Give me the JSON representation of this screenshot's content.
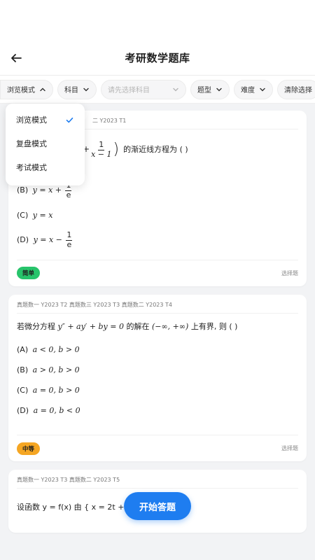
{
  "header": {
    "title": "考研数学题库"
  },
  "filters": {
    "mode": "浏览模式",
    "subject": "科目",
    "subject_select_placeholder": "请先选择科目",
    "type": "题型",
    "difficulty": "难度",
    "clear": "清除选择"
  },
  "mode_menu": {
    "items": [
      "浏览模式",
      "复盘模式",
      "考试模式"
    ],
    "selected_index": 0
  },
  "questions": [
    {
      "tags": "二 Y2023 T1",
      "stem_tail": "的渐近线方程为 (     )",
      "options": [
        {
          "label": "(B)",
          "expr": "y = x +"
        },
        {
          "label": "(C)",
          "expr": "y = x"
        },
        {
          "label": "(D)",
          "expr": "y = x −"
        }
      ],
      "fraction_num": "1",
      "fraction_den_stem": "x − 1",
      "fraction_den_opt": "e",
      "difficulty": "简单",
      "type": "选择题"
    },
    {
      "tags": "真题数一 Y2023 T2 真题数三 Y2023 T3 真题数二 Y2023 T4",
      "stem_a": "若微分方程",
      "stem_eq": "y″ + ay′ + by = 0",
      "stem_b": "的解在",
      "stem_interval": "(−∞, +∞)",
      "stem_c": "上有界, 则 (     )",
      "options": [
        {
          "label": "(A)",
          "expr": "a < 0, b > 0"
        },
        {
          "label": "(B)",
          "expr": "a > 0, b > 0"
        },
        {
          "label": "(C)",
          "expr": "a = 0, b > 0"
        },
        {
          "label": "(D)",
          "expr": "a = 0, b < 0"
        }
      ],
      "difficulty": "中等",
      "type": "选择题"
    },
    {
      "tags": "真题数一 Y2023 T3 真题数二 Y2023 T5",
      "stem_partial": "设函数 y = f(x) 由 { x = 2t + |t|, 确定, 则 (    )"
    }
  ],
  "fab": {
    "label": "开始答题"
  },
  "colors": {
    "accent": "#1e7df0",
    "easy": "#27c46b",
    "medium": "#f5a623"
  }
}
